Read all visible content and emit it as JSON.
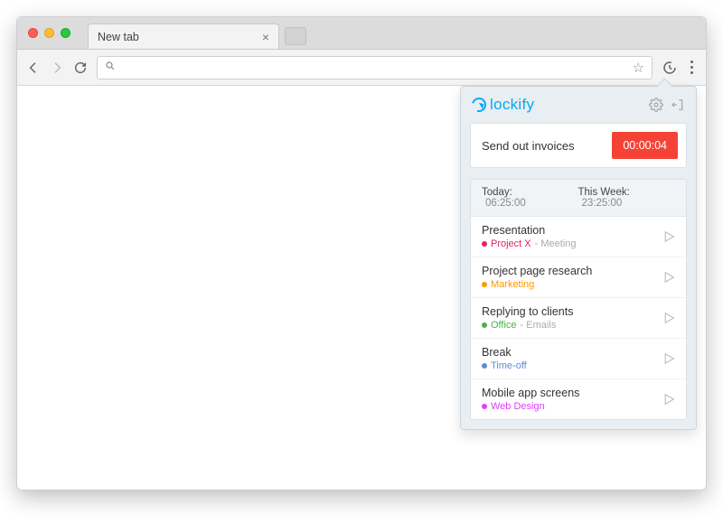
{
  "browser": {
    "tab_title": "New tab"
  },
  "popup": {
    "brand": "lockify",
    "current": {
      "task": "Send out invoices",
      "timer": "00:00:04"
    },
    "summary": {
      "today_label": "Today:",
      "today_value": "06:25:00",
      "week_label": "This Week:",
      "week_value": "23:25:00"
    },
    "entries": [
      {
        "title": "Presentation",
        "project": "Project X",
        "tag": "Meeting",
        "color": "#e91e63"
      },
      {
        "title": "Project page research",
        "project": "Marketing",
        "tag": "",
        "color": "#ff9800"
      },
      {
        "title": "Replying to clients",
        "project": "Office",
        "tag": "Emails",
        "color": "#4caf50"
      },
      {
        "title": "Break",
        "project": "Time-off",
        "tag": "",
        "color": "#5c8bd6"
      },
      {
        "title": "Mobile app screens",
        "project": "Web Design",
        "tag": "",
        "color": "#e040fb"
      }
    ]
  }
}
